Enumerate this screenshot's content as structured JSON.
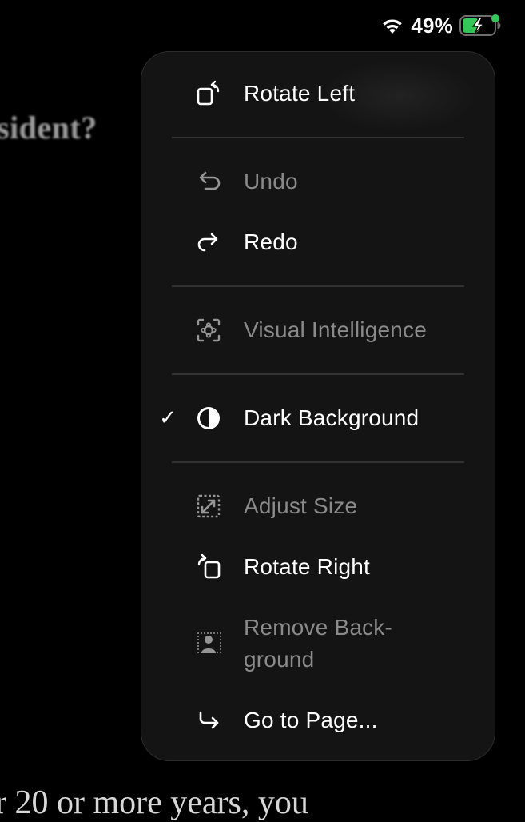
{
  "status": {
    "battery_percent": "49%",
    "battery_level": 0.49,
    "charging": true,
    "indicator_color": "#34c759"
  },
  "background": {
    "top_text": "sident?",
    "bottom_text": "r 20 or more years, you"
  },
  "menu": {
    "rotate_left": "Rotate Left",
    "undo": "Undo",
    "redo": "Redo",
    "visual_intelligence": "Visual Intelligence",
    "dark_background": "Dark Background",
    "dark_background_checked": true,
    "adjust_size": "Adjust Size",
    "rotate_right": "Rotate Right",
    "remove_background_line1": "Remove Back-",
    "remove_background_line2": "ground",
    "go_to_page": "Go to Page..."
  },
  "icons": {
    "rotate_left": "rotate-left-icon",
    "undo": "undo-icon",
    "redo": "redo-icon",
    "visual_intelligence": "visual-intelligence-icon",
    "dark_background": "contrast-icon",
    "adjust_size": "adjust-size-icon",
    "rotate_right": "rotate-right-icon",
    "remove_background": "remove-background-icon",
    "go_to_page": "go-to-page-icon"
  }
}
